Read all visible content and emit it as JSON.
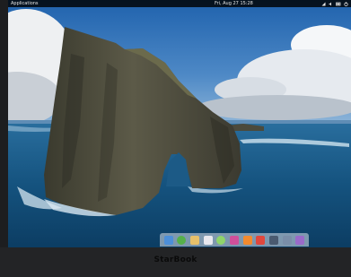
{
  "topbar": {
    "applications_label": "Applications",
    "clock": "Fri, Aug 27 15:28"
  },
  "dock": {
    "items": [
      {
        "name": "files",
        "color": "#4d8fd9"
      },
      {
        "name": "web-browser",
        "color": "#55b04a"
      },
      {
        "name": "mail",
        "color": "#e6c06a"
      },
      {
        "name": "calendar",
        "color": "#e8e8ee"
      },
      {
        "name": "music",
        "color": "#8fd46a"
      },
      {
        "name": "photos",
        "color": "#cf4f9a"
      },
      {
        "name": "videos",
        "color": "#f28a2e"
      },
      {
        "name": "app-store",
        "color": "#e0473d"
      },
      {
        "name": "terminal",
        "color": "#4a5a70"
      },
      {
        "name": "settings",
        "color": "#7a8ea8"
      },
      {
        "name": "system-monitor",
        "color": "#9a6ac9"
      }
    ]
  },
  "device": {
    "brand": "StarBook"
  }
}
